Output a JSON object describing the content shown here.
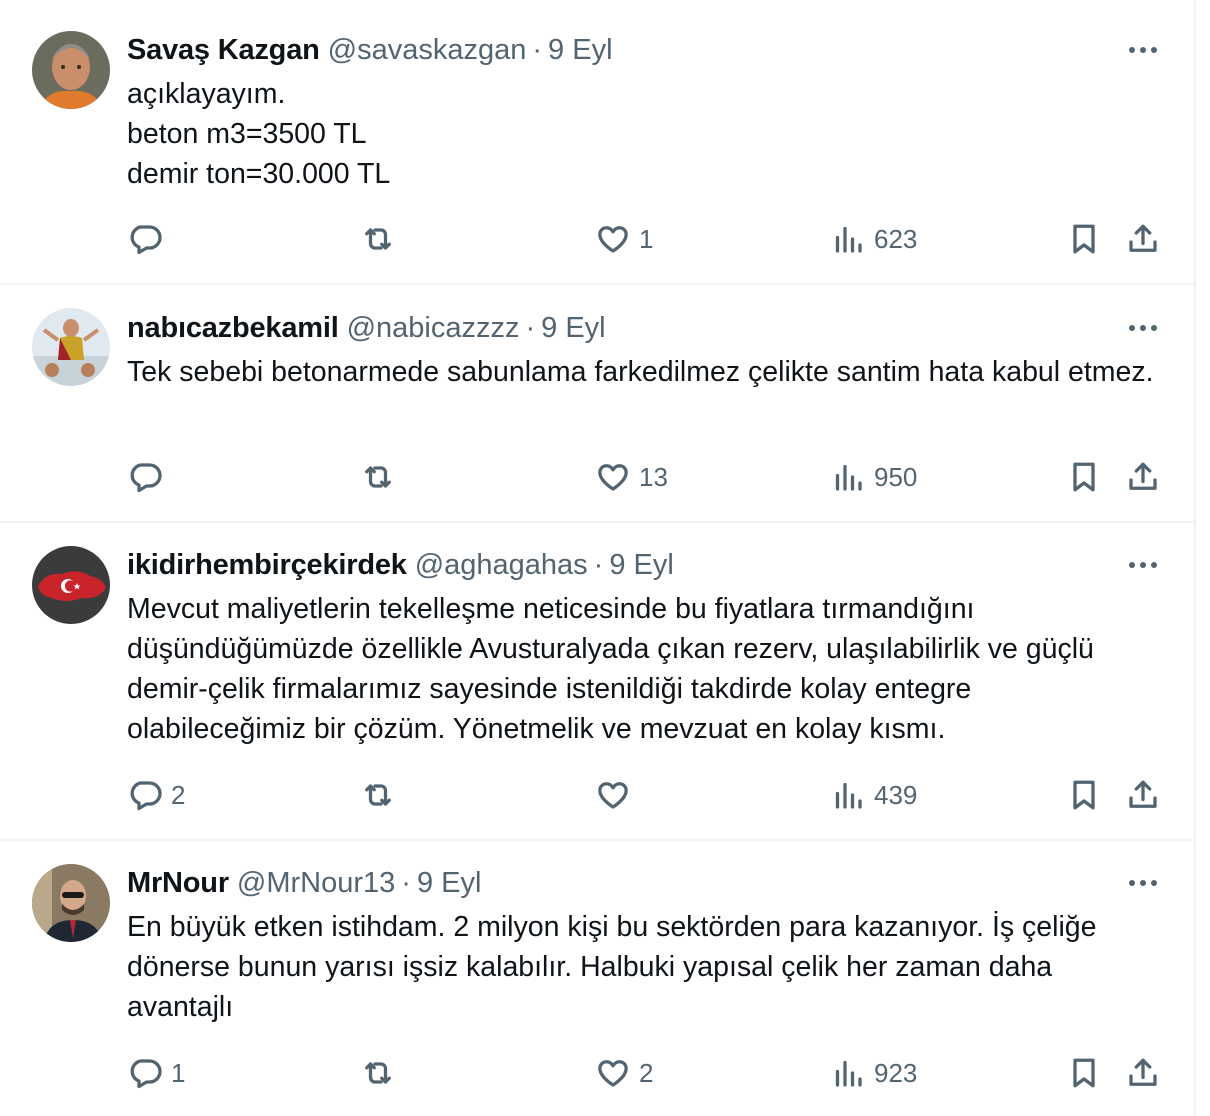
{
  "tweets": [
    {
      "name": "Savaş Kazgan",
      "handle": "@savaskazgan",
      "separator": "·",
      "time": "9 Eyl",
      "text": "açıklayayım.\nbeton m3=3500 TL\ndemir ton=30.000 TL",
      "replies": "",
      "retweets": "",
      "likes": "1",
      "views": "623"
    },
    {
      "name": "nabıcazbekamil",
      "handle": "@nabicazzzz",
      "separator": "·",
      "time": "9 Eyl",
      "text": "Tek sebebi betonarmede sabunlama farkedilmez çelikte santim hata kabul etmez.",
      "replies": "",
      "retweets": "",
      "likes": "13",
      "views": "950"
    },
    {
      "name": "ikidirhembirçekirdek",
      "handle": "@aghagahas",
      "separator": "·",
      "time": "9 Eyl",
      "text": "Mevcut maliyetlerin tekelleşme neticesinde bu fiyatlara tırmandığını düşündüğümüzde özellikle Avusturalyada çıkan rezerv, ulaşılabilirlik ve güçlü demir-çelik firmalarımız sayesinde istenildiği takdirde kolay entegre olabileceğimiz bir çözüm. Yönetmelik ve mevzuat en kolay kısmı.",
      "replies": "2",
      "retweets": "",
      "likes": "",
      "views": "439"
    },
    {
      "name": "MrNour",
      "handle": "@MrNour13",
      "separator": "·",
      "time": "9 Eyl",
      "text": "En büyük etken istihdam. 2 milyon kişi bu sektörden para kazanıyor. İş çeliğe dönerse bunun yarısı işsiz kalabılır. Halbuki yapısal çelik her zaman daha avantajlı",
      "replies": "1",
      "retweets": "",
      "likes": "2",
      "views": "923"
    }
  ],
  "icons": {
    "more": "more-horizontal-icon",
    "reply": "reply-icon",
    "retweet": "retweet-icon",
    "like": "heart-icon",
    "views": "views-icon",
    "bookmark": "bookmark-icon",
    "share": "share-icon"
  },
  "colors": {
    "text": "#0f1419",
    "secondary": "#536471",
    "divider": "#eff3f4"
  }
}
